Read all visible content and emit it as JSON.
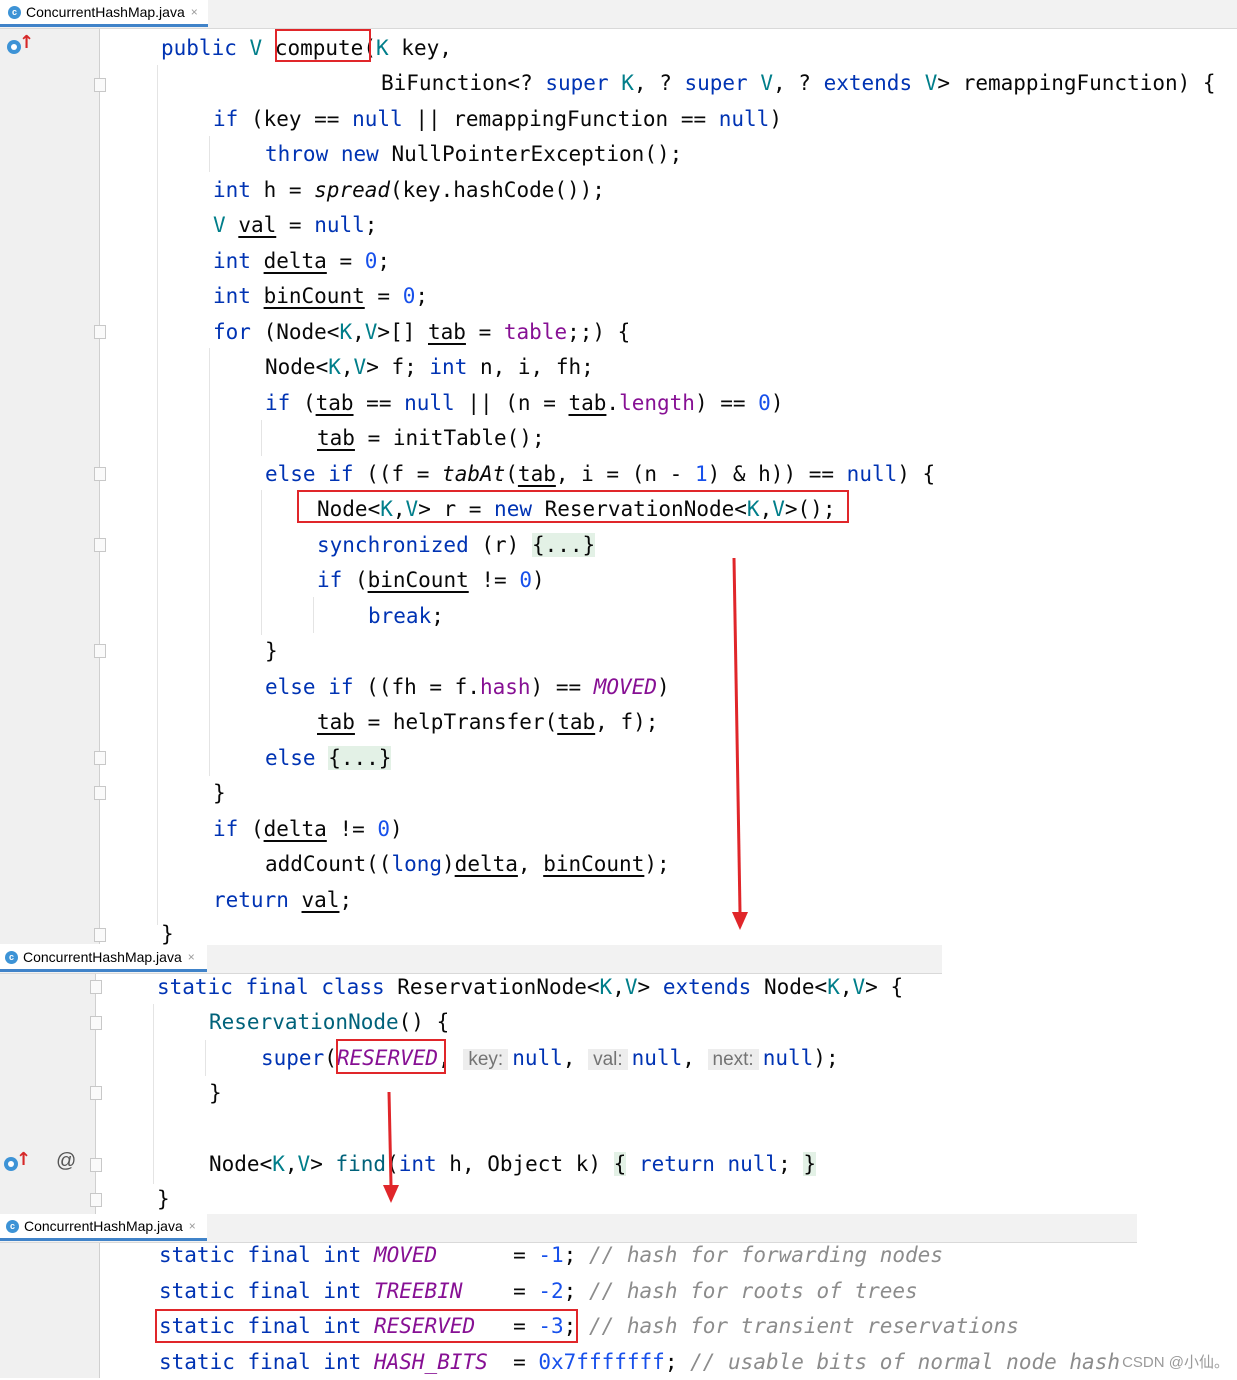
{
  "tabs": {
    "file_name": "ConcurrentHashMap.java",
    "close_glyph": "×",
    "class_icon_letter": "c"
  },
  "gutter": {
    "at_symbol": "@"
  },
  "colors": {
    "keyword": "#0033b3",
    "type_param": "#007e8a",
    "number": "#1750eb",
    "field": "#871094",
    "comment": "#8c8c8c",
    "highlight_box": "#e0262a",
    "arrow": "#e0262a"
  },
  "code_compute": {
    "l1_public": "public",
    "l1_V": "V",
    "l1_compute": "compute",
    "l1_paren": "(",
    "l1_K": "K",
    "l1_key": " key,",
    "l2_bifunction": "BiFunction<? ",
    "l2_super1": "super",
    "l2_sp1": " ",
    "l2_K": "K",
    "l2_mid1": ", ? ",
    "l2_super2": "super",
    "l2_sp2": " ",
    "l2_V": "V",
    "l2_mid2": ", ? ",
    "l2_extends": "extends",
    "l2_sp3": " ",
    "l2_V2": "V",
    "l2_end": "> remappingFunction) {",
    "l3_if": "if",
    "l3_a": " (key == ",
    "l3_null1": "null",
    "l3_b": " || remappingFunction == ",
    "l3_null2": "null",
    "l3_c": ")",
    "l4_throw": "throw",
    "l4_new": "new",
    "l4_rest": " NullPointerException();",
    "l5_int": "int",
    "l5_a": " h = ",
    "l5_spread": "spread",
    "l5_b": "(key.hashCode());",
    "l6_V": "V",
    "l6_val": "val",
    "l6_a": " = ",
    "l6_null": "null",
    "l6_b": ";",
    "l7_int": "int",
    "l7_delta": "delta",
    "l7_a": " = ",
    "l7_zero": "0",
    "l7_b": ";",
    "l8_int": "int",
    "l8_binCount": "binCount",
    "l8_a": " = ",
    "l8_zero": "0",
    "l8_b": ";",
    "l9_for": "for",
    "l9_a": " (Node<",
    "l9_K": "K",
    "l9_comma": ",",
    "l9_V": "V",
    "l9_b": ">[] ",
    "l9_tab": "tab",
    "l9_c": " = ",
    "l9_table": "table",
    "l9_d": ";;) {",
    "l10_a": "Node<",
    "l10_K": "K",
    "l10_comma": ",",
    "l10_V": "V",
    "l10_b": "> f; ",
    "l10_int": "int",
    "l10_c": " n, i, fh;",
    "l11_if": "if",
    "l11_a": " (",
    "l11_tab": "tab",
    "l11_b": " == ",
    "l11_null": "null",
    "l11_c": " || (n = ",
    "l11_tab2": "tab",
    "l11_dot": ".",
    "l11_length": "length",
    "l11_d": ") == ",
    "l11_zero": "0",
    "l11_e": ")",
    "l12_tab": "tab",
    "l12_a": " = initTable();",
    "l13_else": "else",
    "l13_if": "if",
    "l13_a": " ((f = ",
    "l13_tabAt": "tabAt",
    "l13_b": "(",
    "l13_tab": "tab",
    "l13_c": ", i = (n - ",
    "l13_one": "1",
    "l13_d": ") & h)) == ",
    "l13_null": "null",
    "l13_e": ") {",
    "l14_a": "Node<",
    "l14_K": "K",
    "l14_comma": ",",
    "l14_V": "V",
    "l14_b": "> r = ",
    "l14_new": "new",
    "l14_c": " ReservationNode<",
    "l14_K2": "K",
    "l14_comma2": ",",
    "l14_V2": "V",
    "l14_d": ">();",
    "l15_sync": "synchronized",
    "l15_a": " (r) ",
    "l15_fold": "{...}",
    "l16_if": "if",
    "l16_a": " (",
    "l16_binCount": "binCount",
    "l16_b": " != ",
    "l16_zero": "0",
    "l16_c": ")",
    "l17_break": "break",
    "l17_a": ";",
    "l18_brace": "}",
    "l19_else": "else",
    "l19_if": "if",
    "l19_a": " ((fh = f.",
    "l19_hash": "hash",
    "l19_b": ") == ",
    "l19_moved": "MOVED",
    "l19_c": ")",
    "l20_tab": "tab",
    "l20_a": " = helpTransfer(",
    "l20_tab2": "tab",
    "l20_b": ", f);",
    "l21_else": "else",
    "l21_fold": "{...}",
    "l22_brace": "}",
    "l23_if": "if",
    "l23_a": " (",
    "l23_delta": "delta",
    "l23_b": " != ",
    "l23_zero": "0",
    "l23_c": ")",
    "l24_a": "addCount((",
    "l24_long": "long",
    "l24_b": ")",
    "l24_delta": "delta",
    "l24_c": ", ",
    "l24_binCount": "binCount",
    "l24_d": ");",
    "l25_return": "return",
    "l25_val": "val",
    "l25_a": ";",
    "l26_brace": "}"
  },
  "code_reservation": {
    "l1_static": "static",
    "l1_final": "final",
    "l1_class": "class",
    "l1_a": " ReservationNode<",
    "l1_K": "K",
    "l1_comma": ",",
    "l1_V": "V",
    "l1_b": "> ",
    "l1_extends": "extends",
    "l1_c": " Node<",
    "l1_K2": "K",
    "l1_comma2": ",",
    "l1_V2": "V",
    "l1_d": "> {",
    "l2_ctor": "ReservationNode",
    "l2_a": "() {",
    "l3_super": "super",
    "l3_a": "(",
    "l3_reserved": "RESERVED",
    "l3_b": ", ",
    "l3_hint_key": "key:",
    "l3_null1": "null",
    "l3_c": ", ",
    "l3_hint_val": "val:",
    "l3_null2": "null",
    "l3_d": ", ",
    "l3_hint_next": "next:",
    "l3_null3": "null",
    "l3_e": ");",
    "l4_brace": "}",
    "l5_a": "Node<",
    "l5_K": "K",
    "l5_comma": ",",
    "l5_V": "V",
    "l5_b": "> ",
    "l5_find": "find",
    "l5_c": "(",
    "l5_int": "int",
    "l5_d": " h, Object k) ",
    "l5_fold_open": "{",
    "l5_return": "return",
    "l5_null": "null",
    "l5_e": ";",
    "l5_fold_close": "}",
    "l6_brace": "}"
  },
  "code_constants": {
    "rows": [
      {
        "name": "MOVED",
        "pad": "     ",
        "value": "-1",
        "comment": "// hash for forwarding nodes"
      },
      {
        "name": "TREEBIN",
        "pad": "   ",
        "value": "-2",
        "comment": "// hash for roots of trees"
      },
      {
        "name": "RESERVED",
        "pad": "  ",
        "value": "-3",
        "comment": "// hash for transient reservations"
      },
      {
        "name": "HASH_BITS",
        "pad": " ",
        "value": "0x7fffffff",
        "comment": "// usable bits of normal node hash"
      }
    ],
    "static": "static",
    "final": "final",
    "int": "int"
  },
  "watermark": "CSDN @小仙。"
}
